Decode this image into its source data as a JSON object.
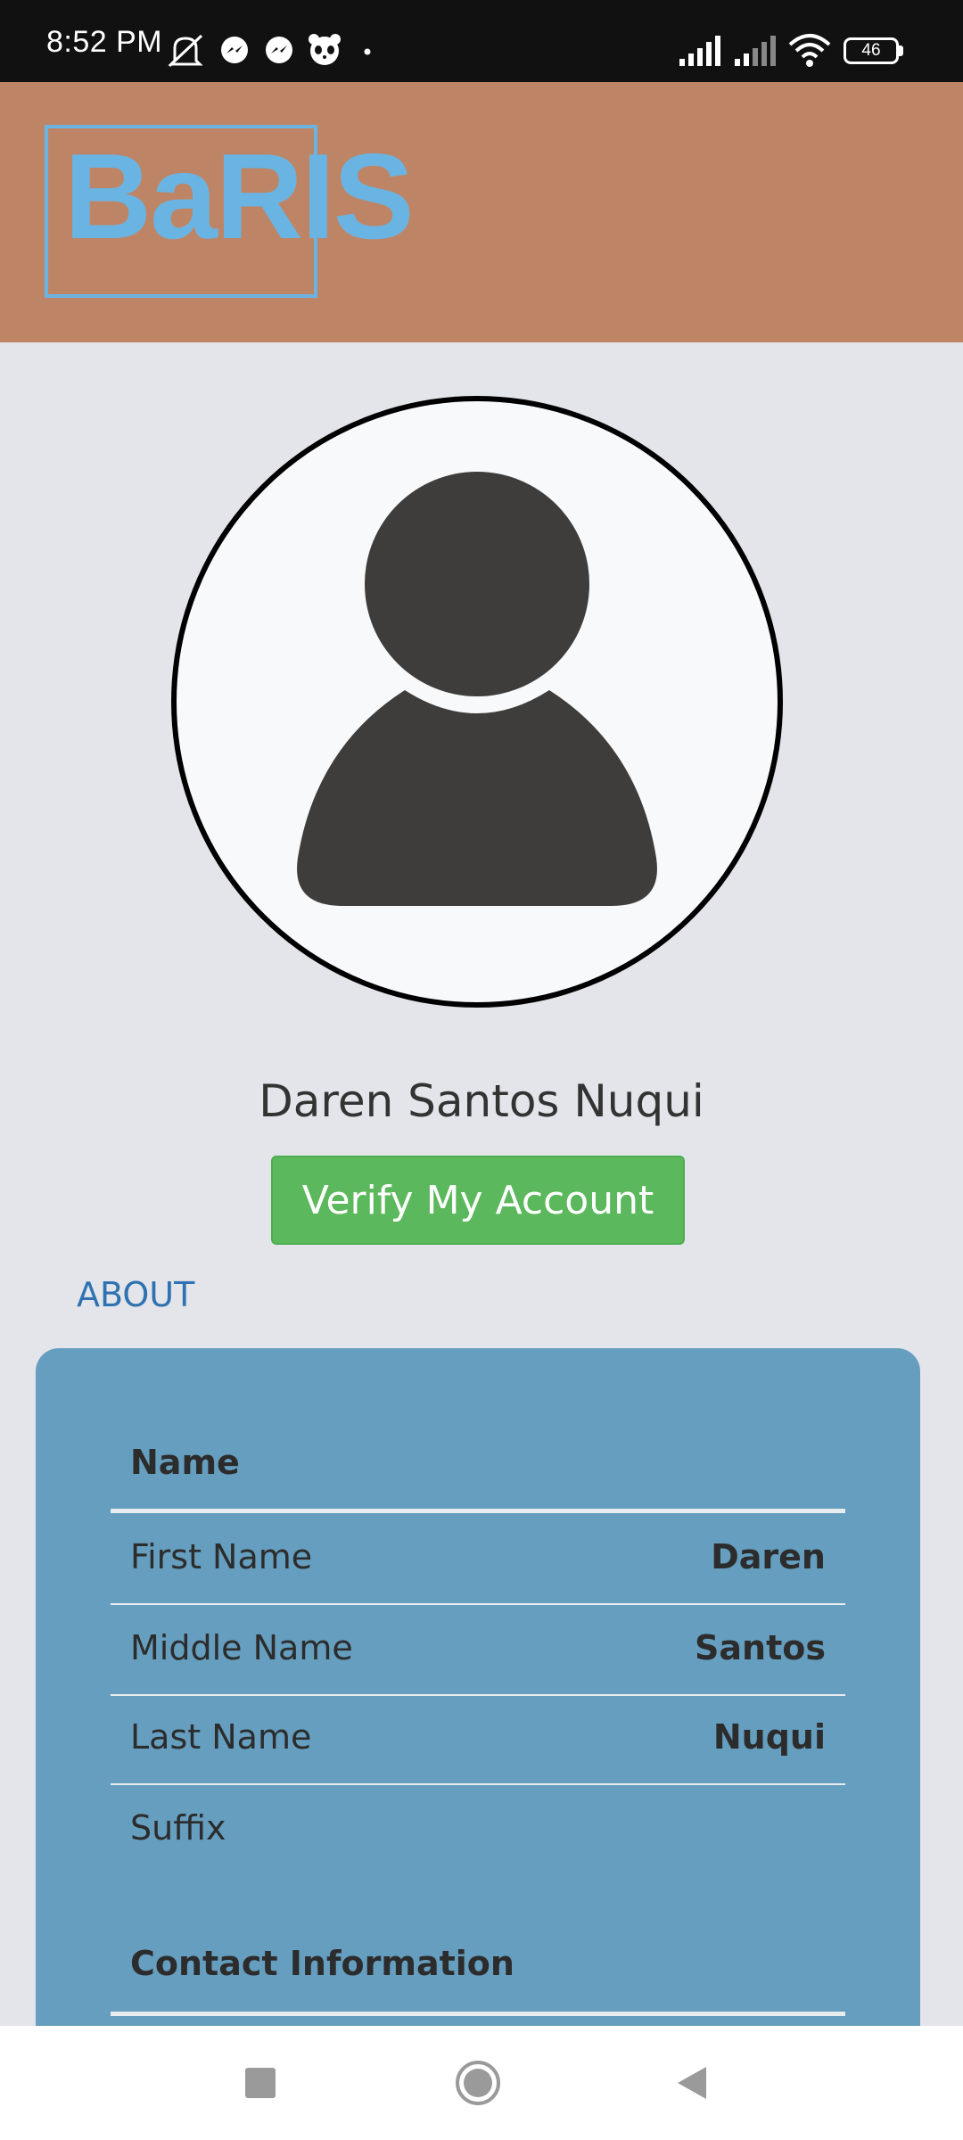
{
  "status_bar": {
    "time": "8:52 PM",
    "battery": "46",
    "icons": [
      "mute-icon",
      "messenger-icon",
      "messenger-icon",
      "panda-app-icon",
      "dot-icon",
      "signal-icon",
      "signal-icon",
      "wifi-icon",
      "battery-icon"
    ]
  },
  "header": {
    "logo_text": "BaRIS",
    "background": "#bd8566",
    "logo_color": "#6ab4e4"
  },
  "profile": {
    "avatar_icon": "user-icon",
    "full_name": "Daren Santos Nuqui",
    "verify_button": "Verify My Account",
    "verify_color": "#5cb85c"
  },
  "tabs": {
    "about": "ABOUT"
  },
  "info_card": {
    "background": "#659ebf",
    "name_section": {
      "title": "Name",
      "rows": [
        {
          "label": "First Name",
          "value": "Daren"
        },
        {
          "label": "Middle Name",
          "value": "Santos"
        },
        {
          "label": "Last Name",
          "value": "Nuqui"
        },
        {
          "label": "Suffix",
          "value": ""
        }
      ]
    },
    "contact_section": {
      "title": "Contact Information"
    }
  },
  "nav_bar": {
    "icons": [
      "recents-square-icon",
      "home-circle-icon",
      "back-triangle-icon"
    ]
  }
}
